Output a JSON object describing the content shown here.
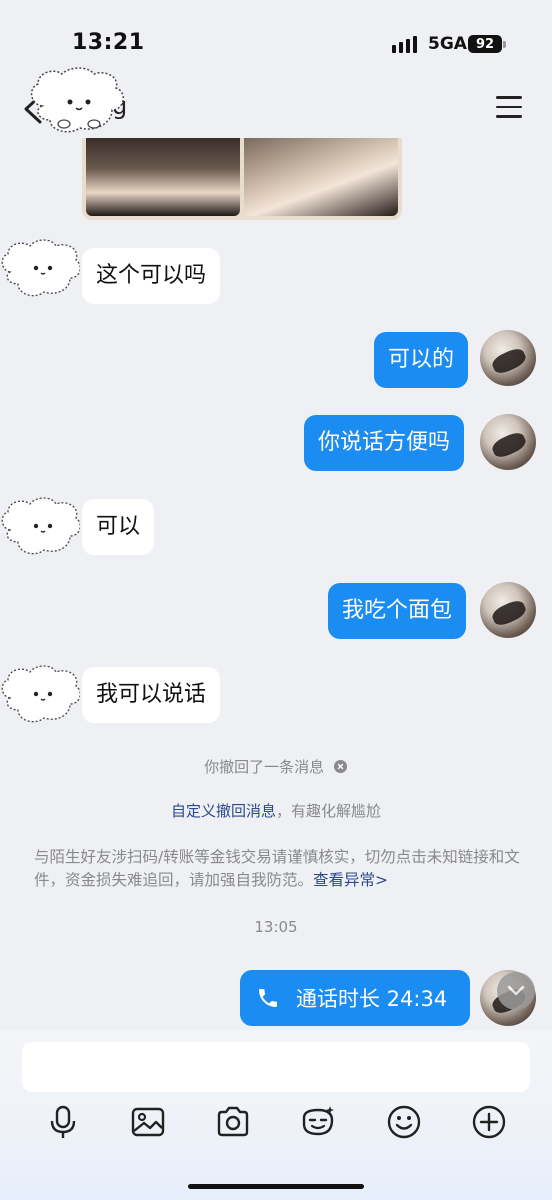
{
  "status_bar": {
    "time": "13:21",
    "network": "5GA",
    "battery": "92"
  },
  "header": {
    "contact_name_fragment": "g"
  },
  "messages": {
    "m1": "这个可以吗",
    "m2": "可以的",
    "m3": "你说话方便吗",
    "m4": "可以",
    "m5": "我吃个面包",
    "m6": "我可以说话"
  },
  "system": {
    "recalled": "你撤回了一条消息",
    "custom_recall_link": "自定义撤回消息",
    "custom_recall_suffix": "，有趣化解尴尬",
    "warning_text": "与陌生好友涉扫码/转账等金钱交易请谨慎核实，切勿点击未知链接和文件，资金损失难追回，请加强自我防范。",
    "warning_link": "查看异常>",
    "timestamp": "13:05"
  },
  "call": {
    "label": "通话时长 24:34"
  },
  "colors": {
    "bubble_right": "#1a8cf2",
    "bubble_left": "#ffffff",
    "background": "#eef0f4",
    "link": "#2b4a8b"
  },
  "toolbar_icons": [
    "microphone-icon",
    "image-icon",
    "camera-icon",
    "sticker-icon",
    "emoji-icon",
    "plus-icon"
  ]
}
